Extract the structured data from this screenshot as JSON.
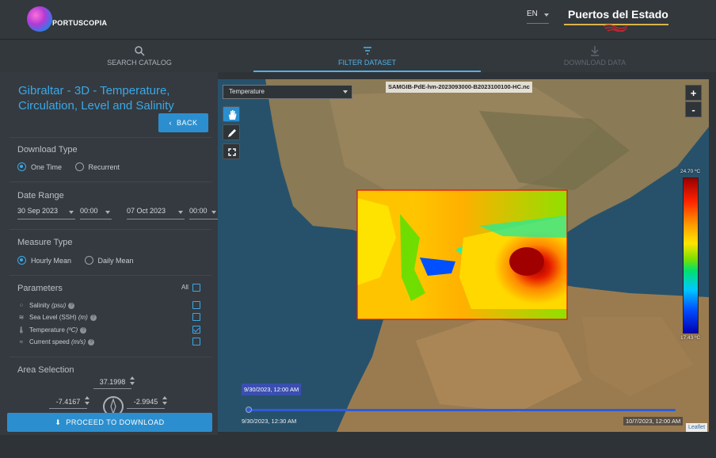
{
  "header": {
    "app_name": "PORTUSCOPIA",
    "language": "EN",
    "brand": "Puertos del Estado"
  },
  "tabs": [
    {
      "label": "SEARCH CATALOG",
      "icon": "search-icon"
    },
    {
      "label": "FILTER DATASET",
      "icon": "filter-icon"
    },
    {
      "label": "DOWNLOAD DATA",
      "icon": "download-icon"
    }
  ],
  "panel": {
    "title": "Gibraltar - 3D - Temperature, Circulation, Level and Salinity",
    "back_label": "BACK",
    "download_type": {
      "title": "Download Type",
      "options": [
        "One Time",
        "Recurrent"
      ],
      "selected": "One Time"
    },
    "date_range": {
      "title": "Date Range",
      "start_date": "30 Sep 2023",
      "start_time": "00:00",
      "end_date": "07 Oct 2023",
      "end_time": "00:00"
    },
    "measure_type": {
      "title": "Measure Type",
      "options": [
        "Hourly Mean",
        "Daily Mean"
      ],
      "selected": "Hourly Mean"
    },
    "parameters": {
      "title": "Parameters",
      "all_label": "All",
      "items": [
        {
          "name": "Salinity",
          "unit": "(psu)",
          "checked": false,
          "icon": "salinity-icon"
        },
        {
          "name": "Sea Level (SSH)",
          "unit": "(m)",
          "checked": false,
          "icon": "sea-level-icon"
        },
        {
          "name": "Temperature",
          "unit": "(ºC)",
          "checked": true,
          "icon": "thermometer-icon"
        },
        {
          "name": "Current speed",
          "unit": "(m/s)",
          "checked": false,
          "icon": "current-icon"
        }
      ]
    },
    "area_selection": {
      "title": "Area Selection",
      "north": "37.1998",
      "west": "-7.4167",
      "east": "-2.9945"
    },
    "proceed_label": "PROCEED TO DOWNLOAD"
  },
  "map": {
    "variable": "Temperature",
    "filename": "SAMGIB-PdE-hm-2023093000-B2023100100-HC.nc",
    "zoom_in": "+",
    "zoom_out": "-",
    "legend_max": "24.70 ºC",
    "legend_min": "17.43 ºC",
    "current_time": "9/30/2023, 12:00 AM",
    "time_start": "9/30/2023, 12:30 AM",
    "time_end": "10/7/2023, 12:00 AM",
    "attribution": "Leaflet"
  },
  "colors": {
    "accent": "#2b8fcf",
    "title": "#3aa8e6",
    "panel": "#353a40"
  }
}
